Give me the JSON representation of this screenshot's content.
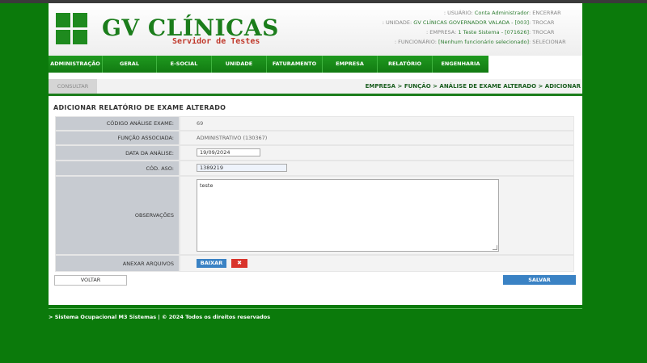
{
  "header": {
    "brand": "GV CLÍNICAS",
    "subtitle": "Servidor de Testes",
    "info": [
      {
        "label": ": USUÁRIO:",
        "value": "Conta Administrador",
        "action": ": ENCERRAR"
      },
      {
        "label": ": UNIDADE:",
        "value": "GV CLÍNICAS GOVERNADOR VALADA - [003]",
        "action": ": TROCAR"
      },
      {
        "label": ": EMPRESA:",
        "value": "1 Teste Sistema - [071626]",
        "action": ": TROCAR"
      },
      {
        "label": ": FUNCIONÁRIO:",
        "value": "[Nenhum funcionário selecionado]",
        "action": ": SELECIONAR"
      }
    ]
  },
  "nav": [
    "ADMINISTRAÇÃO",
    "GERAL",
    "E-SOCIAL",
    "UNIDADE",
    "FATURAMENTO",
    "EMPRESA",
    "RELATÓRIO",
    "ENGENHARIA"
  ],
  "tab": {
    "label": "CONSULTAR"
  },
  "breadcrumb": "EMPRESA > FUNÇÃO > ANÁLISE DE EXAME ALTERADO > ADICIONAR",
  "page_title": "ADICIONAR RELATÓRIO DE EXAME ALTERADO",
  "form": {
    "codigo_label": "CÓDIGO ANÁLISE EXAME:",
    "codigo_value": "69",
    "funcao_label": "FUNÇÃO ASSOCIADA:",
    "funcao_value": "ADMINISTRATIVO (130367)",
    "data_label": "DATA DA ANÁLISE:",
    "data_value": "19/09/2024",
    "aso_label": "CÓD. ASO:",
    "aso_value": "1389219",
    "obs_label": "OBSERVAÇÕES",
    "obs_value": "teste",
    "anexar_label": "ANEXAR ARQUIVOS",
    "baixar_label": "BAIXAR",
    "delete_glyph": "✖"
  },
  "buttons": {
    "voltar": "VOLTAR",
    "salvar": "SALVAR"
  },
  "footer": "> Sistema Ocupacional M3 Sistemas | © 2024 Todos os direitos reservados",
  "colors": {
    "brand_green": "#1b7d1b",
    "background": "#0b7a0b",
    "button_blue": "#3a82c4",
    "delete_red": "#d9342b"
  }
}
